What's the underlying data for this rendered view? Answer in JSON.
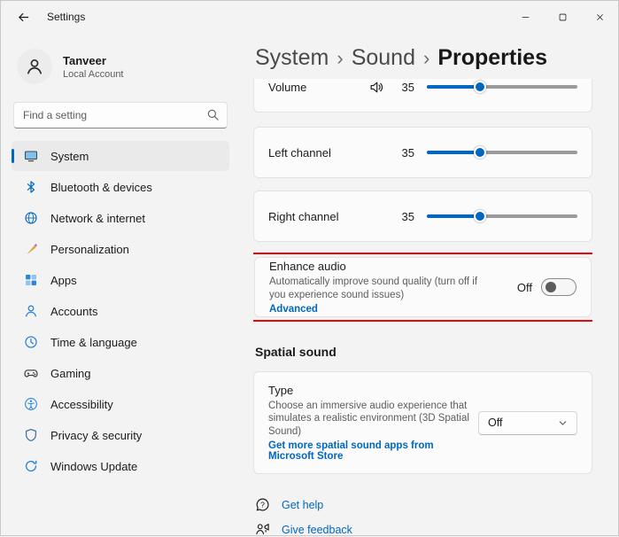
{
  "window": {
    "title": "Settings"
  },
  "sidebar": {
    "user": {
      "name": "Tanveer",
      "account_type": "Local Account"
    },
    "search": {
      "placeholder": "Find a setting"
    },
    "items": [
      {
        "label": "System",
        "selected": true
      },
      {
        "label": "Bluetooth & devices",
        "selected": false
      },
      {
        "label": "Network & internet",
        "selected": false
      },
      {
        "label": "Personalization",
        "selected": false
      },
      {
        "label": "Apps",
        "selected": false
      },
      {
        "label": "Accounts",
        "selected": false
      },
      {
        "label": "Time & language",
        "selected": false
      },
      {
        "label": "Gaming",
        "selected": false
      },
      {
        "label": "Accessibility",
        "selected": false
      },
      {
        "label": "Privacy & security",
        "selected": false
      },
      {
        "label": "Windows Update",
        "selected": false
      }
    ]
  },
  "breadcrumb": {
    "items": [
      "System",
      "Sound",
      "Properties"
    ],
    "separator": "›"
  },
  "content": {
    "volume": {
      "label": "Volume",
      "value": "35",
      "percent": 35
    },
    "left_channel": {
      "label": "Left channel",
      "value": "35",
      "percent": 35
    },
    "right_channel": {
      "label": "Right channel",
      "value": "35",
      "percent": 35
    },
    "enhance_audio": {
      "title": "Enhance audio",
      "description": "Automatically improve sound quality (turn off if you experience sound issues)",
      "advanced_link": "Advanced",
      "toggle_label": "Off",
      "toggle_state": "off"
    },
    "spatial_sound": {
      "heading": "Spatial sound",
      "type": {
        "title": "Type",
        "description": "Choose an immersive audio experience that simulates a realistic environment (3D Spatial Sound)",
        "store_link": "Get more spatial sound apps from Microsoft Store",
        "dropdown_value": "Off"
      }
    },
    "footer": {
      "get_help": "Get help",
      "give_feedback": "Give feedback"
    }
  },
  "annotation": {
    "color": "#e60b0b",
    "target": "Enhance audio card"
  },
  "colors": {
    "accent": "#0067c0",
    "card_bg": "#fbfbfb",
    "page_bg": "#f3f3f3",
    "slider_fill": "#0067c0"
  },
  "icons": [
    "back-icon",
    "minimize-icon",
    "maximize-icon",
    "close-icon",
    "avatar-person-icon",
    "search-icon",
    "system-icon",
    "bluetooth-icon",
    "network-icon",
    "personalization-icon",
    "apps-icon",
    "accounts-icon",
    "time-language-icon",
    "gaming-icon",
    "accessibility-icon",
    "privacy-icon",
    "windows-update-icon",
    "speaker-icon",
    "dropdown-chevron-icon",
    "get-help-icon",
    "give-feedback-icon"
  ]
}
